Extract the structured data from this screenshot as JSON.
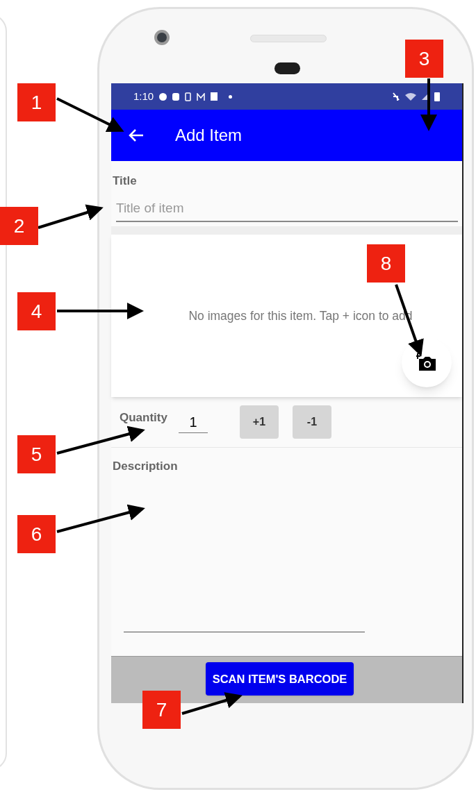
{
  "status_bar": {
    "time": "1:10"
  },
  "app_bar": {
    "title": "Add Item"
  },
  "title_field": {
    "label": "Title",
    "placeholder": "Title of item"
  },
  "images": {
    "empty_text": "No images for this item. Tap + icon to add"
  },
  "quantity": {
    "label": "Quantity",
    "value": "1",
    "buttons": [
      "+1",
      "-1"
    ]
  },
  "description": {
    "label": "Description"
  },
  "scan_button": {
    "label": "SCAN ITEM'S BARCODE"
  },
  "callouts": [
    {
      "label": "1"
    },
    {
      "label": "2"
    },
    {
      "label": "3"
    },
    {
      "label": "4"
    },
    {
      "label": "5"
    },
    {
      "label": "6"
    },
    {
      "label": "7"
    },
    {
      "label": "8"
    }
  ]
}
